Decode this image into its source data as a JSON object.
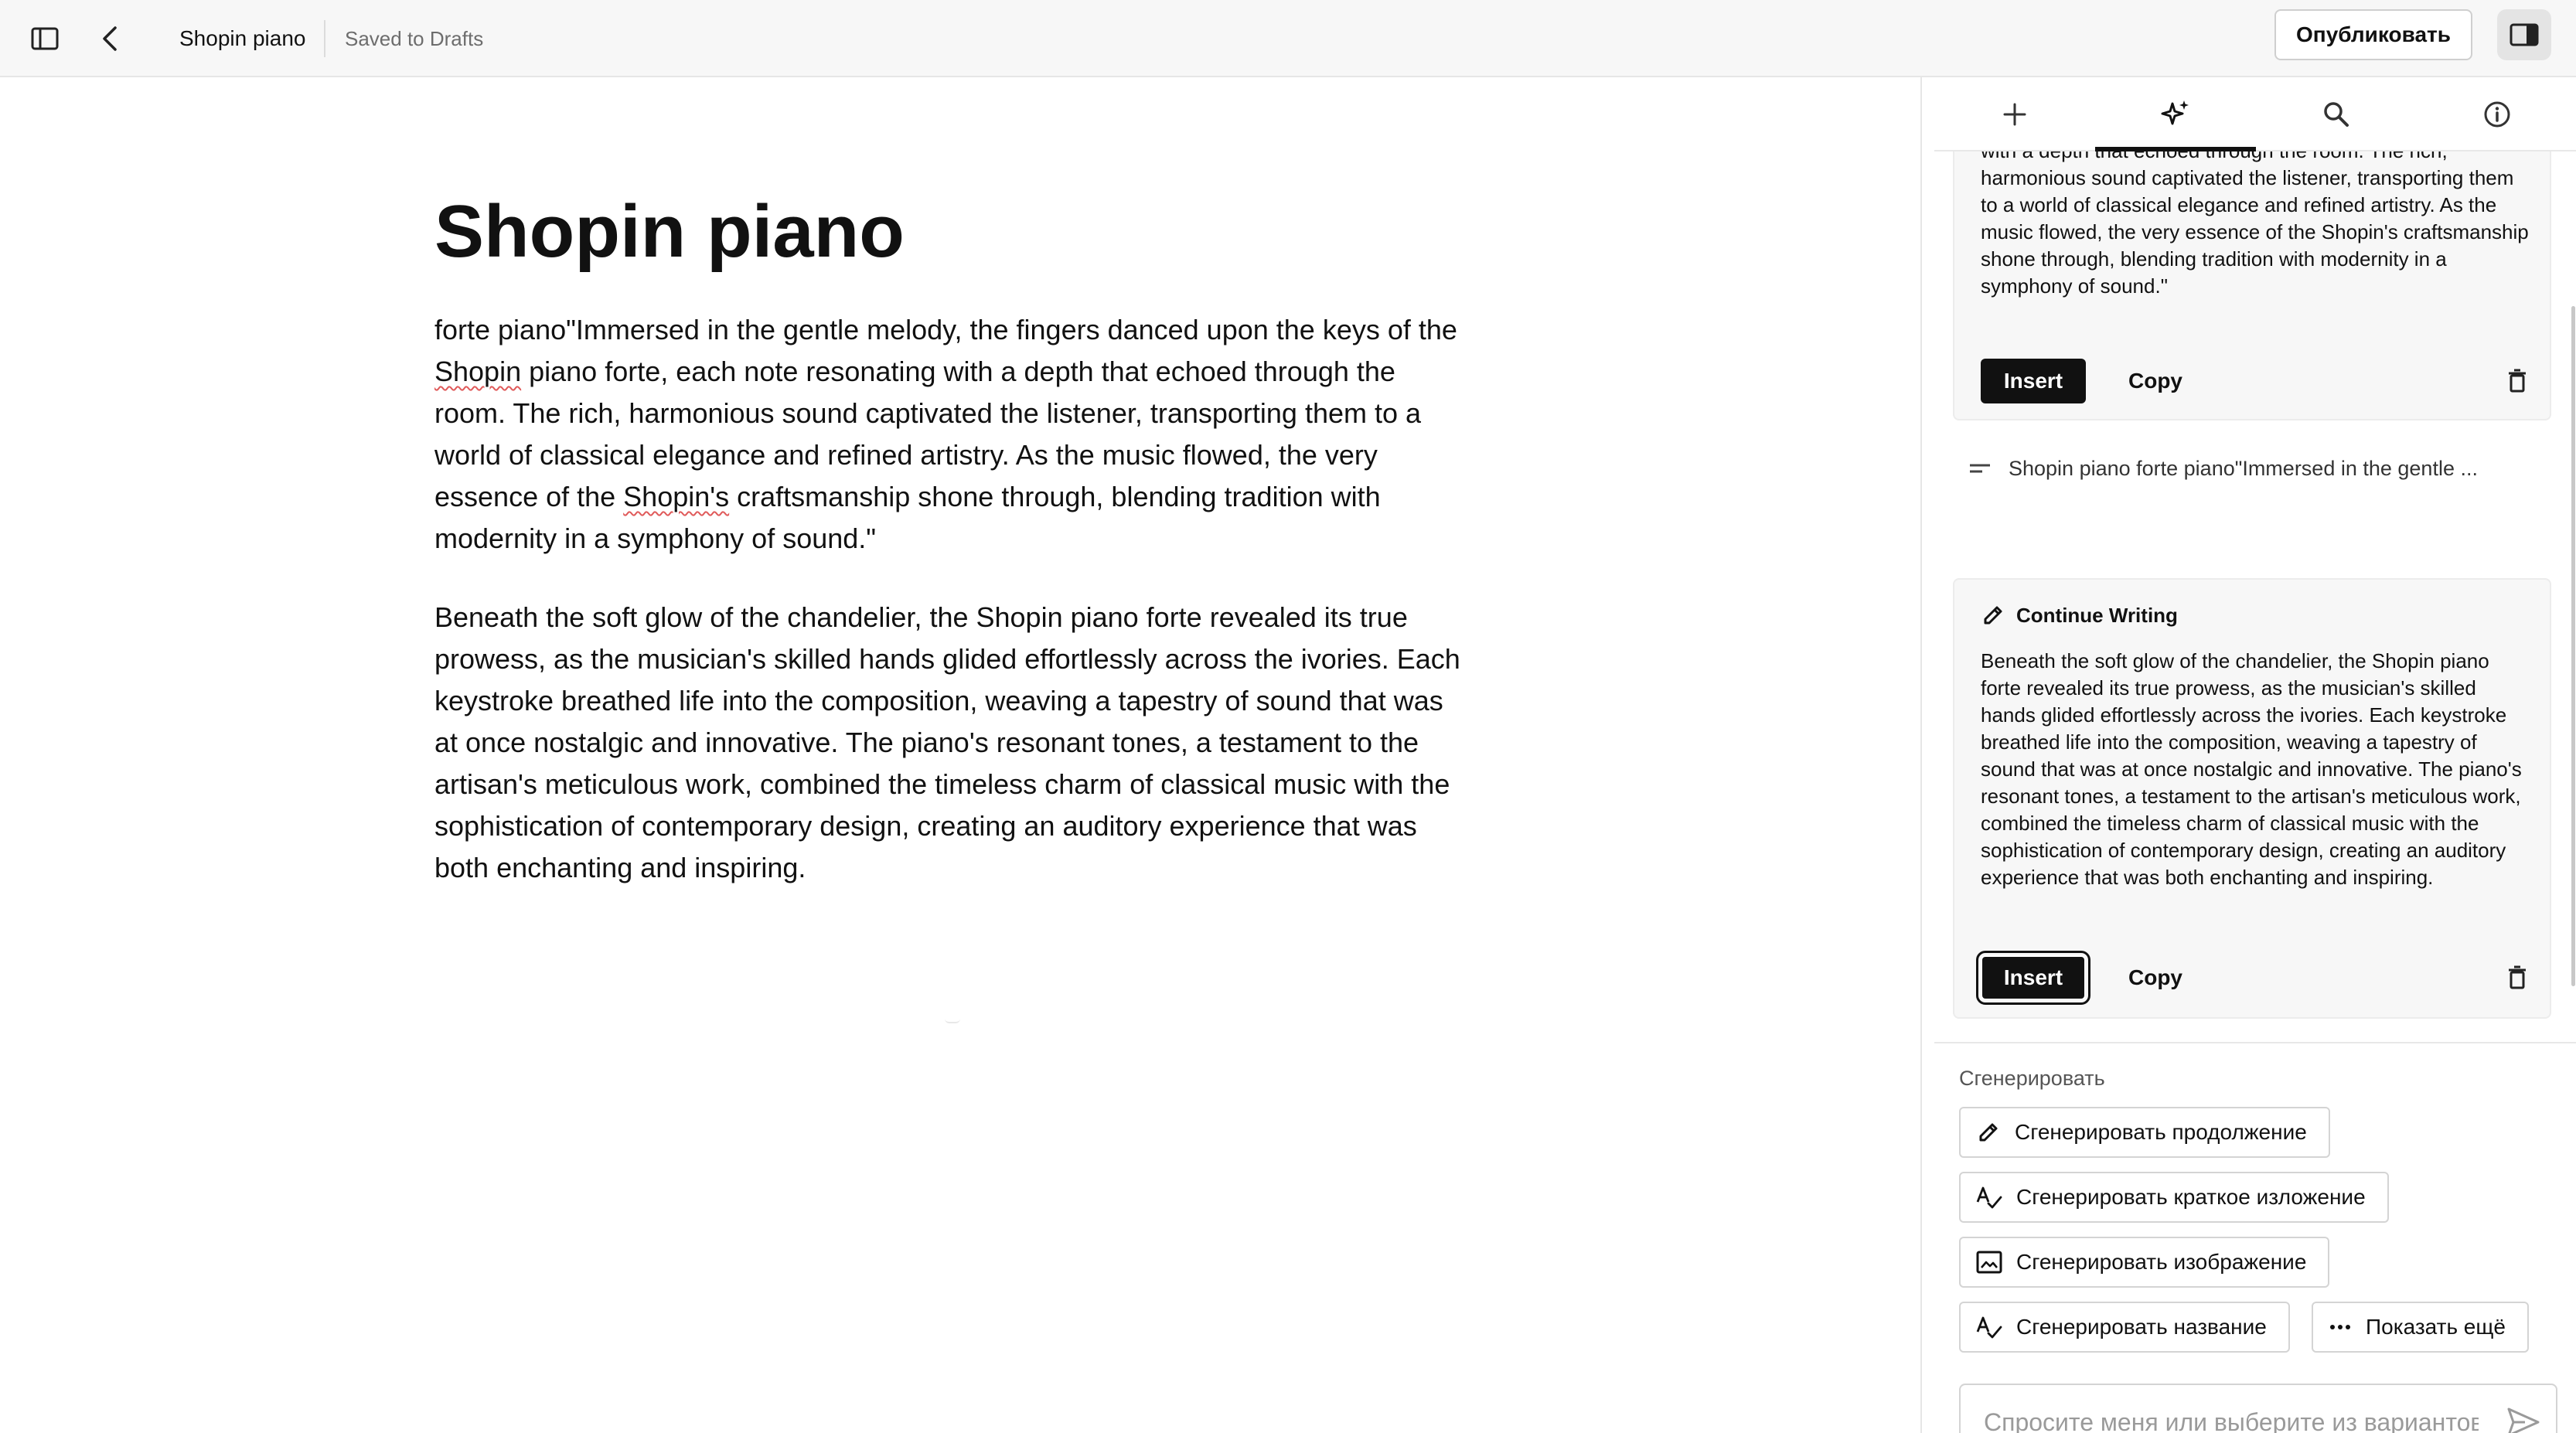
{
  "topbar": {
    "doc_title": "Shopin piano",
    "saved_status": "Saved to Drafts",
    "publish_label": "Опубликовать"
  },
  "editor": {
    "title": "Shopin piano",
    "paragraph1": {
      "before": "forte piano\"Immersed in the gentle melody, the fingers danced upon the keys of the ",
      "word1": "Shopin",
      "middle": " piano forte, each note resonating with a depth that echoed through the room. The rich, harmonious sound captivated the listener, transporting them to a world of classical elegance and refined artistry. As the music flowed, the very essence of the ",
      "word2": "Shopin's",
      "after": " craftsmanship shone through, blending tradition with modernity in a symphony of sound.\""
    },
    "paragraph2": "Beneath the soft glow of the chandelier, the Shopin piano forte revealed its true prowess, as the musician's skilled hands glided effortlessly across the ivories. Each keystroke breathed life into the composition, weaving a tapestry of sound that was at once nostalgic and innovative. The piano's resonant tones, a testament to the artisan's meticulous work, combined the timeless charm of classical music with the sophistication of contemporary design, creating an auditory experience that was both enchanting and inspiring."
  },
  "panel": {
    "tabs": [
      {
        "icon": "plus-icon"
      },
      {
        "icon": "sparkles-icon",
        "active": true
      },
      {
        "icon": "search-icon"
      },
      {
        "icon": "info-icon"
      }
    ],
    "card1": {
      "text": "with a depth that echoed through the room. The rich, harmonious sound captivated the listener, transporting them to a world of classical elegance and refined artistry. As the music flowed, the very essence of the Shopin's craftsmanship shone through, blending tradition with modernity in a symphony of sound.\"",
      "insert_label": "Insert",
      "copy_label": "Copy"
    },
    "prompt_summary": "Shopin piano forte piano\"Immersed in the gentle ...",
    "card2": {
      "heading": "Continue Writing",
      "text": "Beneath the soft glow of the chandelier, the Shopin piano forte revealed its true prowess, as the musician's skilled hands glided effortlessly across the ivories. Each keystroke breathed life into the composition, weaving a tapestry of sound that was at once nostalgic and innovative. The piano's resonant tones, a testament to the artisan's meticulous work, combined the timeless charm of classical music with the sophistication of contemporary design, creating an auditory experience that was both enchanting and inspiring.",
      "insert_label": "Insert",
      "copy_label": "Copy"
    },
    "generate": {
      "section_label": "Сгенерировать",
      "continue_label": "Сгенерировать продолжение",
      "summary_label": "Сгенерировать краткое изложение",
      "image_label": "Сгенерировать изображение",
      "title_label": "Сгенерировать название",
      "more_label": "Показать ещё"
    },
    "chat": {
      "placeholder": "Спросите меня или выберите из вариантов",
      "value": ""
    }
  },
  "colors": {
    "accent": "#111111",
    "topbar_bg": "#f7f7f7",
    "card_bg": "#f7f7f7",
    "spellcheck": "#e05a5a"
  }
}
